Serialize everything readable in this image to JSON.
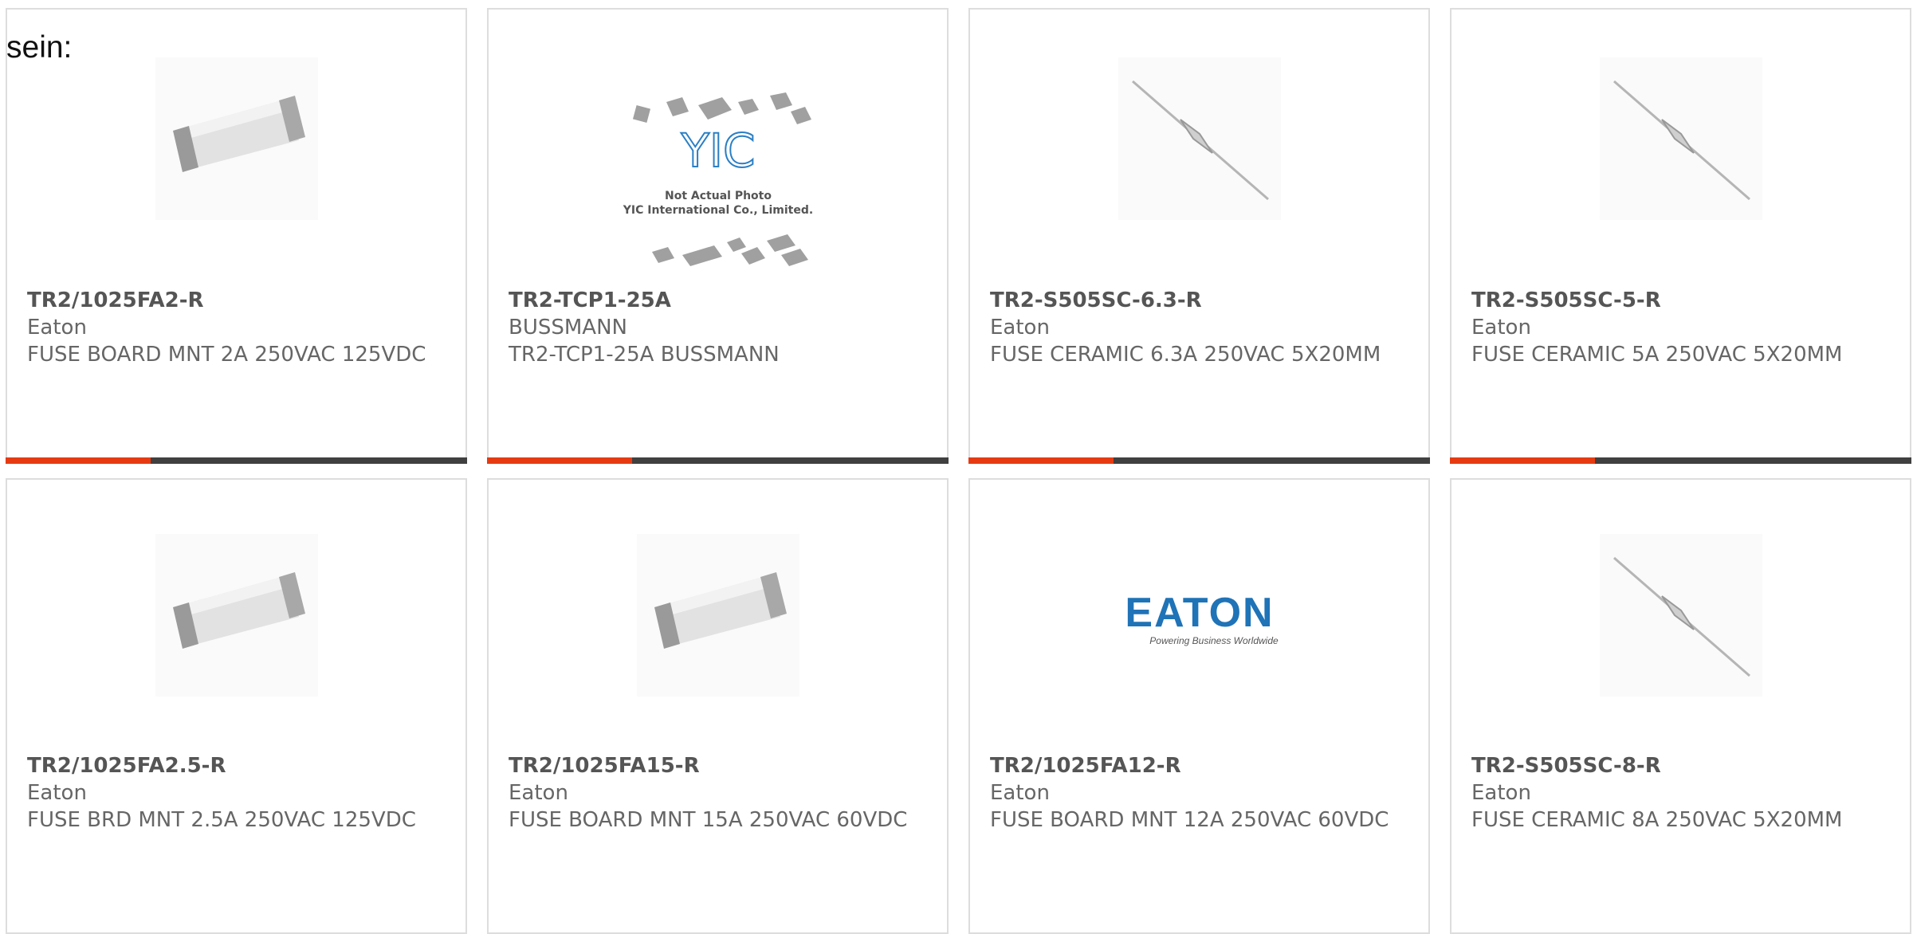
{
  "intro_text": "sein:",
  "colors": {
    "accent": "#e63b12",
    "bar": "#404040",
    "text": "#666666",
    "border": "#dddddd"
  },
  "cards": [
    {
      "part_number": "TR2/1025FA2-R",
      "manufacturer": "Eaton",
      "description": "FUSE BOARD MNT 2A 250VAC 125VDC",
      "image": "smd-fuse-image"
    },
    {
      "part_number": "TR2-TCP1-25A",
      "manufacturer": "BUSSMANN",
      "description": "TR2-TCP1-25A BUSSMANN",
      "image": "yic-placeholder-image",
      "image_text": {
        "logo": "YIC",
        "line1": "Not Actual Photo",
        "line2": "YIC International Co., Limited."
      }
    },
    {
      "part_number": "TR2-S505SC-6.3-R",
      "manufacturer": "Eaton",
      "description": "FUSE CERAMIC 6.3A 250VAC 5X20MM",
      "image": "axial-fuse-image"
    },
    {
      "part_number": "TR2-S505SC-5-R",
      "manufacturer": "Eaton",
      "description": "FUSE CERAMIC 5A 250VAC 5X20MM",
      "image": "axial-fuse-image"
    },
    {
      "part_number": "TR2/1025FA2.5-R",
      "manufacturer": "Eaton",
      "description": "FUSE BRD MNT 2.5A 250VAC 125VDC",
      "image": "smd-fuse-image"
    },
    {
      "part_number": "TR2/1025FA15-R",
      "manufacturer": "Eaton",
      "description": "FUSE BOARD MNT 15A 250VAC 60VDC",
      "image": "smd-fuse-image"
    },
    {
      "part_number": "TR2/1025FA12-R",
      "manufacturer": "Eaton",
      "description": "FUSE BOARD MNT 12A 250VAC 60VDC",
      "image": "eaton-logo-image",
      "image_text": {
        "logo": "EATON",
        "tagline": "Powering Business Worldwide"
      }
    },
    {
      "part_number": "TR2-S505SC-8-R",
      "manufacturer": "Eaton",
      "description": "FUSE CERAMIC 8A 250VAC 5X20MM",
      "image": "axial-fuse-image"
    }
  ]
}
